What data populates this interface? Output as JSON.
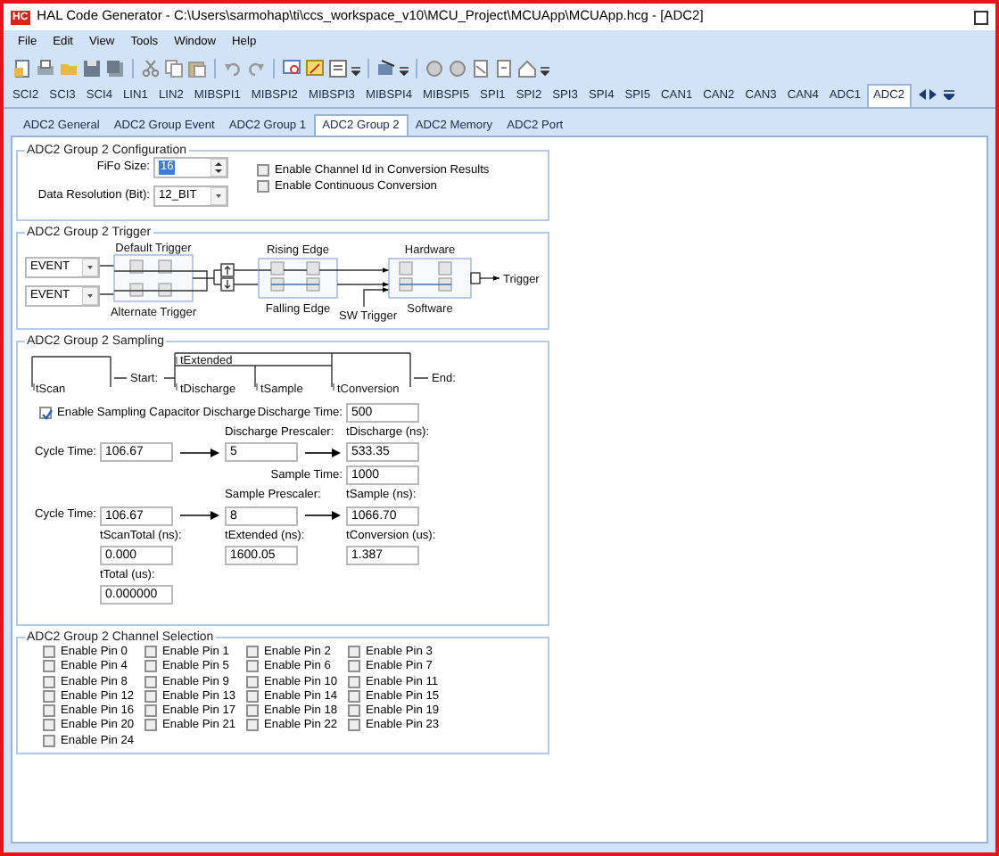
{
  "window": {
    "app_icon": "HC",
    "title": "HAL Code Generator - C:\\Users\\sarmohap\\ti\\ccs_workspace_v10\\MCU_Project\\MCUApp\\MCUApp.hcg - [ADC2]"
  },
  "menu": [
    "File",
    "Edit",
    "View",
    "Tools",
    "Window",
    "Help"
  ],
  "module_tabs": [
    {
      "label": "SCI2",
      "selected": false
    },
    {
      "label": "SCI3",
      "selected": false
    },
    {
      "label": "SCI4",
      "selected": false
    },
    {
      "label": "LIN1",
      "selected": false
    },
    {
      "label": "LIN2",
      "selected": false
    },
    {
      "label": "MIBSPI1",
      "selected": false
    },
    {
      "label": "MIBSPI2",
      "selected": false
    },
    {
      "label": "MIBSPI3",
      "selected": false
    },
    {
      "label": "MIBSPI4",
      "selected": false
    },
    {
      "label": "MIBSPI5",
      "selected": false
    },
    {
      "label": "SPI1",
      "selected": false
    },
    {
      "label": "SPI2",
      "selected": false
    },
    {
      "label": "SPI3",
      "selected": false
    },
    {
      "label": "SPI4",
      "selected": false
    },
    {
      "label": "SPI5",
      "selected": false
    },
    {
      "label": "CAN1",
      "selected": false
    },
    {
      "label": "CAN2",
      "selected": false
    },
    {
      "label": "CAN3",
      "selected": false
    },
    {
      "label": "CAN4",
      "selected": false
    },
    {
      "label": "ADC1",
      "selected": false
    },
    {
      "label": "ADC2",
      "selected": true
    }
  ],
  "sub_tabs": [
    {
      "label": "ADC2 General",
      "selected": false
    },
    {
      "label": "ADC2 Group Event",
      "selected": false
    },
    {
      "label": "ADC2 Group 1",
      "selected": false
    },
    {
      "label": "ADC2 Group 2",
      "selected": true
    },
    {
      "label": "ADC2 Memory",
      "selected": false
    },
    {
      "label": "ADC2 Port",
      "selected": false
    }
  ],
  "configuration": {
    "title": "ADC2 Group 2 Configuration",
    "fifo_size": {
      "label": "FiFo Size:",
      "value": "16",
      "highlighted": true
    },
    "data_resolution": {
      "label": "Data Resolution (Bit):",
      "value": "12_BIT"
    },
    "options": [
      {
        "label": "Enable Channel Id in Conversion Results",
        "checked": false
      },
      {
        "label": "Enable Continuous Conversion",
        "checked": false
      }
    ]
  },
  "trigger": {
    "title": "ADC2 Group 2 Trigger",
    "sources": [
      "EVENT",
      "EVENT"
    ],
    "default_trigger": "Default Trigger",
    "alternate_trigger": "Alternate Trigger",
    "rising_edge": "Rising Edge",
    "falling_edge": "Falling Edge",
    "sw_trigger": "SW Trigger",
    "hardware": "Hardware",
    "software": "Software",
    "output": "Trigger"
  },
  "sampling": {
    "title": "ADC2 Group 2 Sampling",
    "timeline": {
      "scan": "tScan",
      "start": "Start:",
      "extended": "tExtended",
      "discharge": "tDischarge",
      "sample": "tSample",
      "conversion": "tConversion",
      "end": "End:"
    },
    "capacitor_discharge": {
      "label": "Enable Sampling Capacitor Discharge",
      "checked": true
    },
    "discharge_time": {
      "label": "Discharge Time:",
      "value": "500"
    },
    "discharge_row": {
      "cycle_label": "Cycle Time:",
      "cycle_time": "106.67",
      "prescaler_label": "Discharge Prescaler:",
      "prescaler": "5",
      "result_label": "tDischarge (ns):",
      "result": "533.35"
    },
    "sample_time": {
      "label": "Sample Time:",
      "value": "1000"
    },
    "sample_row": {
      "cycle_label": "Cycle Time:",
      "cycle_time": "106.67",
      "prescaler_label": "Sample Prescaler:",
      "prescaler": "8",
      "result_label": "tSample (ns):",
      "result": "1066.70"
    },
    "totals": [
      {
        "label": "tScanTotal (ns):",
        "value": "0.000"
      },
      {
        "label": "tExtended (ns):",
        "value": "1600.05"
      },
      {
        "label": "tConversion (us):",
        "value": "1.387"
      },
      {
        "label": "tTotal (us):",
        "value": "0.000000"
      }
    ]
  },
  "channels": {
    "title": "ADC2 Group 2 Channel Selection",
    "pins": [
      {
        "label": "Enable Pin 0",
        "checked": false
      },
      {
        "label": "Enable Pin 1",
        "checked": false
      },
      {
        "label": "Enable Pin 2",
        "checked": false
      },
      {
        "label": "Enable Pin 3",
        "checked": false
      },
      {
        "label": "Enable Pin 4",
        "checked": false
      },
      {
        "label": "Enable Pin 5",
        "checked": false
      },
      {
        "label": "Enable Pin 6",
        "checked": false
      },
      {
        "label": "Enable Pin 7",
        "checked": false
      },
      {
        "label": "Enable Pin 8",
        "checked": false
      },
      {
        "label": "Enable Pin 9",
        "checked": false
      },
      {
        "label": "Enable Pin 10",
        "checked": false
      },
      {
        "label": "Enable Pin 11",
        "checked": false
      },
      {
        "label": "Enable Pin 12",
        "checked": false
      },
      {
        "label": "Enable Pin 13",
        "checked": false
      },
      {
        "label": "Enable Pin 14",
        "checked": false
      },
      {
        "label": "Enable Pin 15",
        "checked": false
      },
      {
        "label": "Enable Pin 16",
        "checked": false
      },
      {
        "label": "Enable Pin 17",
        "checked": false
      },
      {
        "label": "Enable Pin 18",
        "checked": false
      },
      {
        "label": "Enable Pin 19",
        "checked": false
      },
      {
        "label": "Enable Pin 20",
        "checked": false
      },
      {
        "label": "Enable Pin 21",
        "checked": false
      },
      {
        "label": "Enable Pin 22",
        "checked": false
      },
      {
        "label": "Enable Pin 23",
        "checked": false
      },
      {
        "label": "Enable Pin 24",
        "checked": false
      }
    ]
  }
}
